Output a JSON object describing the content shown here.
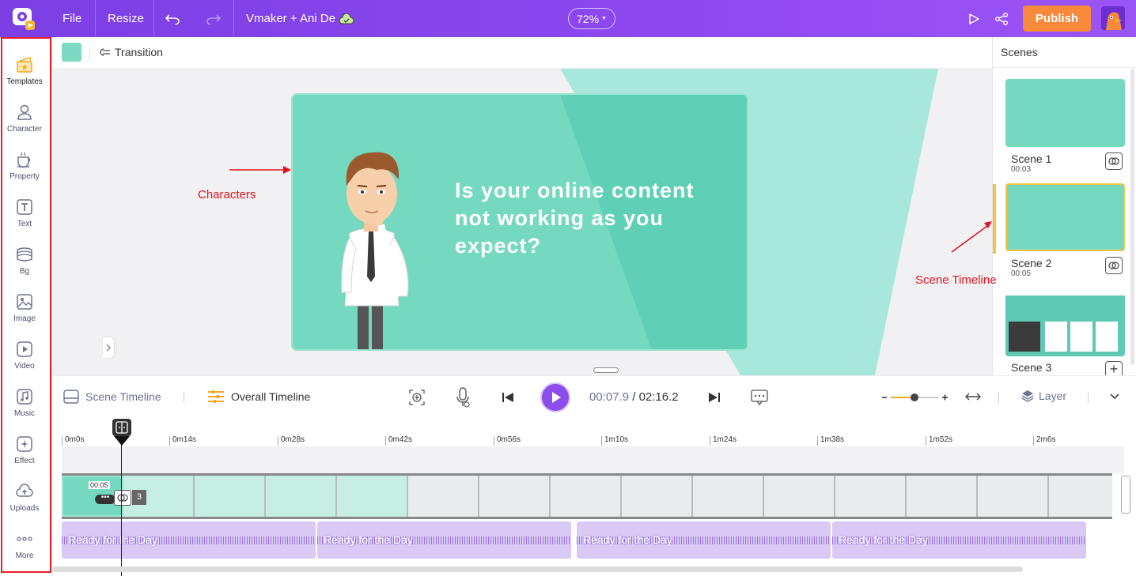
{
  "topbar": {
    "file": "File",
    "resize": "Resize",
    "project_name": "Vmaker + Ani De",
    "zoom": "72%",
    "publish": "Publish"
  },
  "left_panel": {
    "items": [
      {
        "label": "Templates",
        "icon": "templates-icon"
      },
      {
        "label": "Character",
        "icon": "character-icon"
      },
      {
        "label": "Property",
        "icon": "property-icon"
      },
      {
        "label": "Text",
        "icon": "text-icon"
      },
      {
        "label": "Bg",
        "icon": "bg-icon"
      },
      {
        "label": "Image",
        "icon": "image-icon"
      },
      {
        "label": "Video",
        "icon": "video-icon"
      },
      {
        "label": "Music",
        "icon": "music-icon"
      },
      {
        "label": "Effect",
        "icon": "effect-icon"
      },
      {
        "label": "Uploads",
        "icon": "uploads-icon"
      },
      {
        "label": "More",
        "icon": "more-icon"
      }
    ]
  },
  "editor_bar": {
    "transition": "Transition",
    "swatch_color": "#7dd9c2"
  },
  "canvas": {
    "scene_text": "Is your online content not working as you expect?",
    "annotation_characters": "Characters",
    "annotation_scene_timeline": "Scene Timeline"
  },
  "scenes_panel": {
    "title": "Scenes",
    "scenes": [
      {
        "name": "Scene 1",
        "duration": "00:03"
      },
      {
        "name": "Scene 2",
        "duration": "00:05"
      },
      {
        "name": "Scene 3",
        "duration": ""
      }
    ]
  },
  "timeline": {
    "scene_timeline": "Scene Timeline",
    "overall_timeline": "Overall Timeline",
    "current_time": "00:07.9",
    "separator": "/",
    "total_time": "02:16.2",
    "layer": "Layer",
    "ticks": [
      "0m0s",
      "0m14s",
      "0m28s",
      "0m42s",
      "0m56s",
      "1m10s",
      "1m24s",
      "1m38s",
      "1m52s",
      "2m6s"
    ],
    "clip_duration": "00:05",
    "clip_count": "3",
    "audio_clips": [
      "Ready for the Day",
      "Ready for the Day",
      "Ready for the Day",
      "Ready for the Day"
    ]
  },
  "colors": {
    "brand_purple": "#8b4dec",
    "publish_orange": "#f7893b",
    "scene_teal": "#75d9c0",
    "annotation_red": "#e0141e"
  }
}
